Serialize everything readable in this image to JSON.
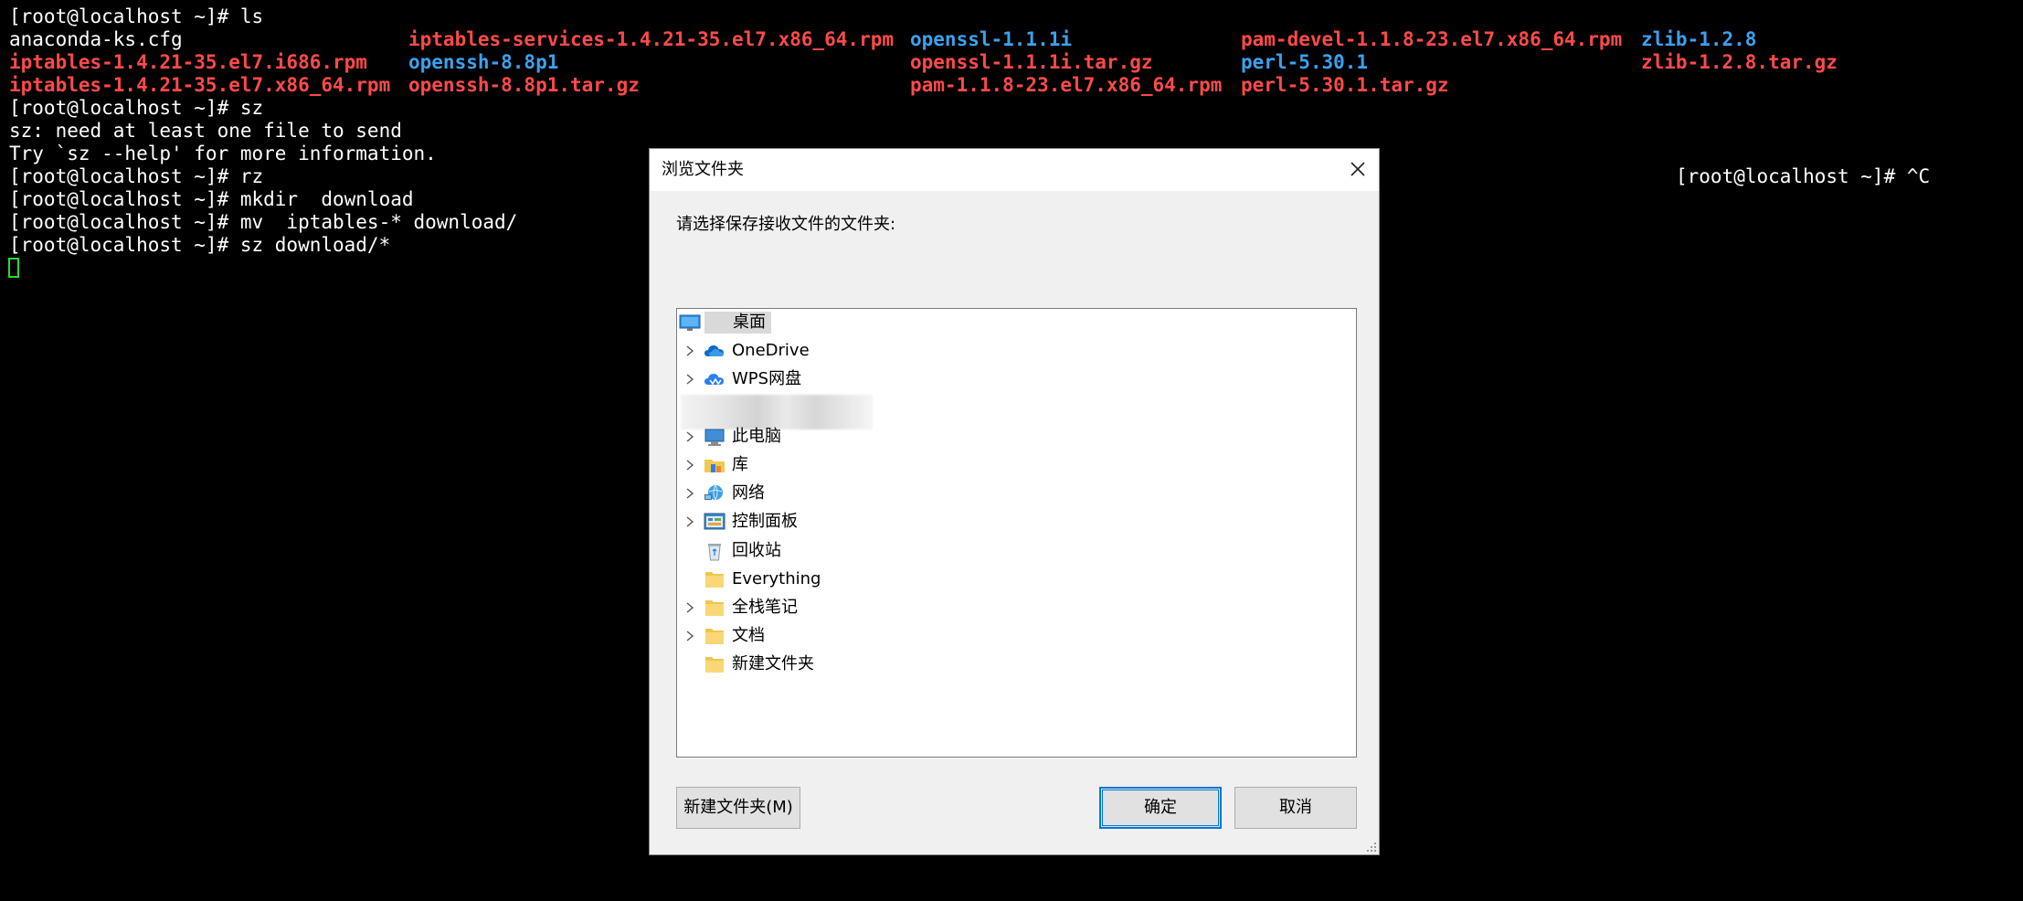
{
  "terminal": {
    "lines": [
      "[root@localhost ~]# ls",
      "",
      "",
      "",
      "[root@localhost ~]# sz",
      "sz: need at least one file to send",
      "Try `sz --help' for more information.",
      "[root@localhost ~]# rz",
      "[root@localhost ~]# mkdir  download",
      "[root@localhost ~]# mv  iptables-* download/",
      "[root@localhost ~]# sz download/*"
    ],
    "ls_row1": [
      {
        "text": "anaconda-ks.cfg",
        "color": "white"
      },
      {
        "text": "iptables-services-1.4.21-35.el7.x86_64.rpm",
        "color": "red"
      },
      {
        "text": "openssl-1.1.1i",
        "color": "blue"
      },
      {
        "text": "pam-devel-1.1.8-23.el7.x86_64.rpm",
        "color": "red"
      },
      {
        "text": "zlib-1.2.8",
        "color": "blue"
      }
    ],
    "ls_row2": [
      {
        "text": "iptables-1.4.21-35.el7.i686.rpm",
        "color": "red"
      },
      {
        "text": "openssh-8.8p1",
        "color": "blue"
      },
      {
        "text": "openssl-1.1.1i.tar.gz",
        "color": "red"
      },
      {
        "text": "perl-5.30.1",
        "color": "blue"
      },
      {
        "text": "zlib-1.2.8.tar.gz",
        "color": "red"
      }
    ],
    "ls_row3": [
      {
        "text": "iptables-1.4.21-35.el7.x86_64.rpm",
        "color": "red"
      },
      {
        "text": "openssh-8.8p1.tar.gz",
        "color": "red"
      },
      {
        "text": "pam-1.1.8-23.el7.x86_64.rpm",
        "color": "red"
      },
      {
        "text": "perl-5.30.1.tar.gz",
        "color": "red"
      }
    ],
    "trailing_prompt": "[root@localhost ~]# ^C",
    "colors": {
      "red": "#ff4a4a",
      "blue": "#3aa2ee",
      "cursor": "#2adb2a"
    }
  },
  "dialog": {
    "title": "浏览文件夹",
    "instruction": "请选择保存接收文件的文件夹:",
    "tree": [
      {
        "label": "桌面",
        "icon": "desktop-icon",
        "expandable": false,
        "selected": true,
        "root": true
      },
      {
        "label": "OneDrive",
        "icon": "onedrive-cloud-icon",
        "expandable": true
      },
      {
        "label": "WPS网盘",
        "icon": "wps-cloud-icon",
        "expandable": true
      },
      {
        "label": "",
        "icon": "blurred-icon",
        "expandable": false,
        "blurred": true
      },
      {
        "label": "此电脑",
        "icon": "computer-icon",
        "expandable": true
      },
      {
        "label": "库",
        "icon": "library-icon",
        "expandable": true
      },
      {
        "label": "网络",
        "icon": "network-icon",
        "expandable": true
      },
      {
        "label": "控制面板",
        "icon": "control-panel-icon",
        "expandable": true
      },
      {
        "label": "回收站",
        "icon": "recycle-bin-icon",
        "expandable": false
      },
      {
        "label": "Everything",
        "icon": "folder-icon",
        "expandable": false
      },
      {
        "label": "全栈笔记",
        "icon": "folder-icon",
        "expandable": true
      },
      {
        "label": "文档",
        "icon": "folder-icon",
        "expandable": true
      },
      {
        "label": "新建文件夹",
        "icon": "folder-icon",
        "expandable": false
      }
    ],
    "buttons": {
      "new_folder": "新建文件夹(M)",
      "ok": "确定",
      "cancel": "取消"
    },
    "accent": "#0078d7"
  }
}
